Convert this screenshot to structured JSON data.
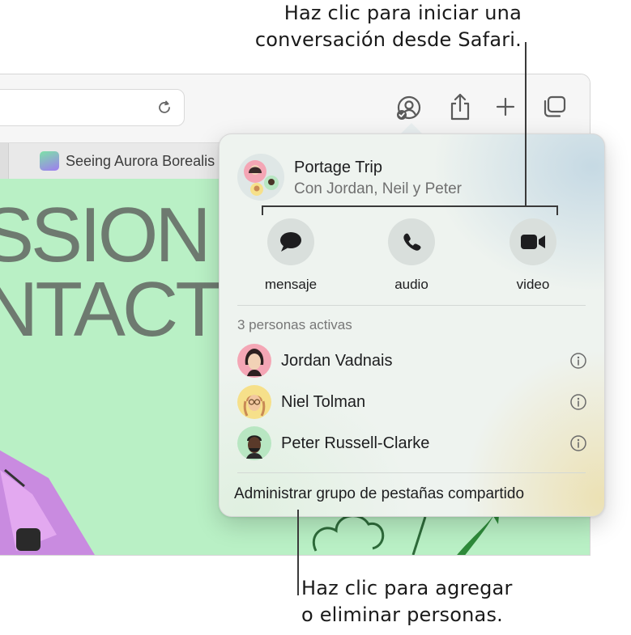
{
  "callouts": {
    "top_line1": "Haz clic para iniciar una",
    "top_line2": "conversación desde Safari.",
    "bottom_line1": "Haz clic para agregar",
    "bottom_line2": "o eliminar personas."
  },
  "tabbar": {
    "tab_title": "Seeing Aurora Borealis"
  },
  "page": {
    "headline_line1": "SSION",
    "headline_line2": "NTACT"
  },
  "popover": {
    "group_name": "Portage Trip",
    "group_members": "Con Jordan, Neil y Peter",
    "actions": [
      {
        "label": "mensaje",
        "icon": "message-bubble-icon"
      },
      {
        "label": "audio",
        "icon": "phone-icon"
      },
      {
        "label": "video",
        "icon": "video-camera-icon"
      }
    ],
    "active_title": "3 personas activas",
    "people": [
      {
        "name": "Jordan Vadnais",
        "avatar_color": "#f4a6b5"
      },
      {
        "name": "Niel Tolman",
        "avatar_color": "#f6e08a"
      },
      {
        "name": "Peter Russell-Clarke",
        "avatar_color": "#b8e6c2"
      }
    ],
    "manage_label": "Administrar grupo de pestañas compartido"
  }
}
